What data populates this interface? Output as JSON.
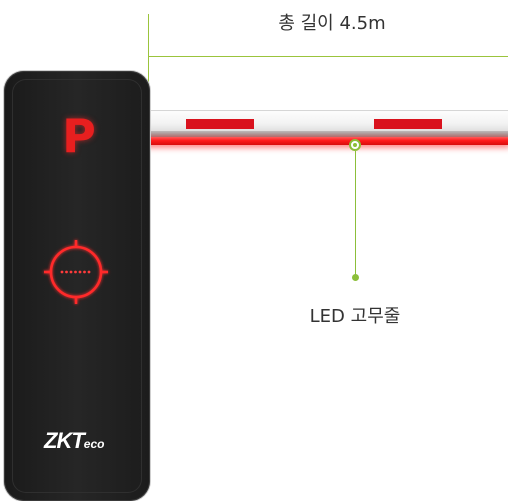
{
  "annotation": {
    "length_label": "총 길이 4.5m",
    "led_label": "LED 고무줄"
  },
  "cabinet": {
    "parking_sign": "P",
    "logo": {
      "main": "ZKT",
      "sub": "eco"
    }
  },
  "colors": {
    "accent_green": "#8cbf3a",
    "stripe_red": "#d9121d",
    "led_red": "#ff1a1a",
    "cabinet_body": "#1f1f1f"
  }
}
